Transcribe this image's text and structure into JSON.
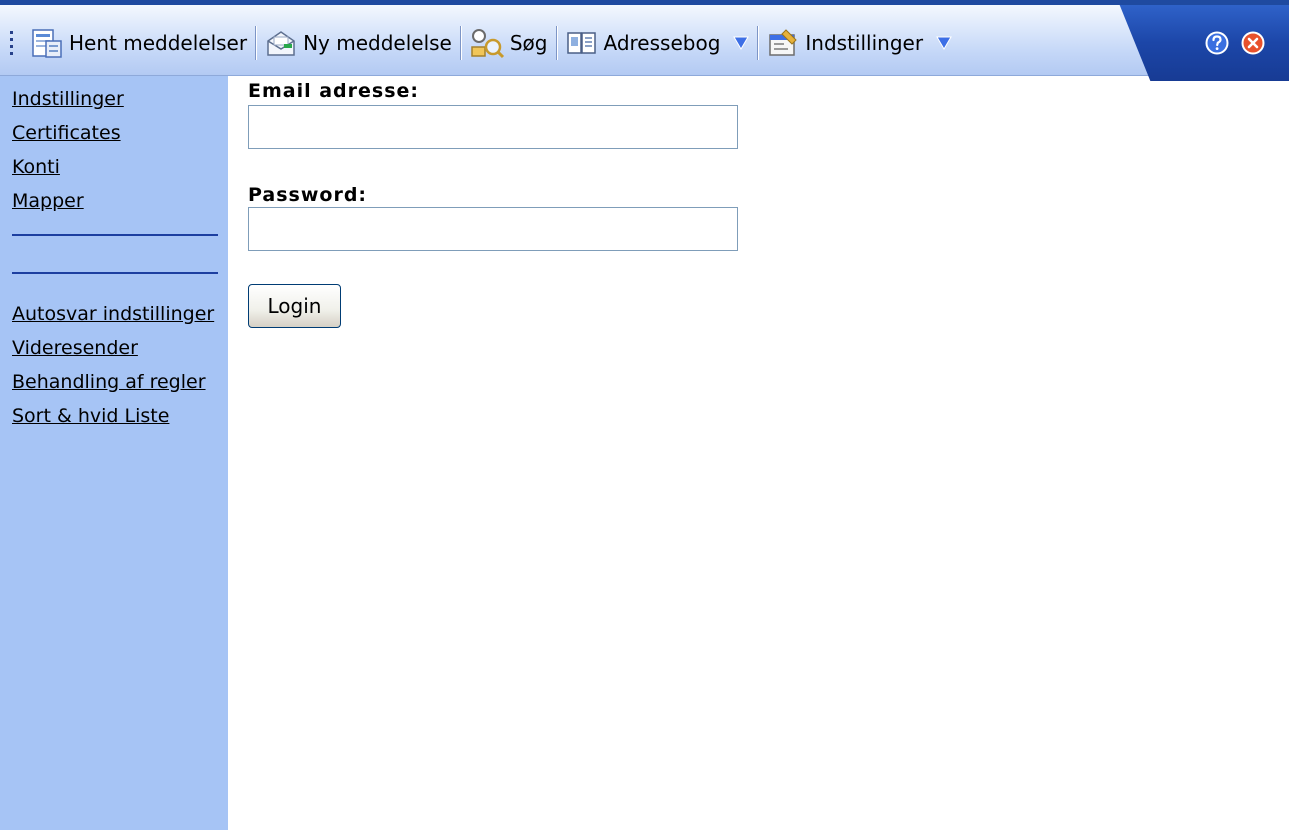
{
  "toolbar": {
    "get_messages": "Hent meddelelser",
    "new_message": "Ny meddelelse",
    "search": "Søg",
    "address_book": "Adressebog",
    "settings": "Indstillinger"
  },
  "sidebar": {
    "top_links": [
      "Indstillinger",
      "Certificates",
      "Konti",
      "Mapper"
    ],
    "bottom_links": [
      "Autosvar indstillinger",
      "Videresender",
      "Behandling af regler",
      "Sort & hvid Liste"
    ]
  },
  "form": {
    "email_label": "Email adresse:",
    "email_value": "",
    "password_label": "Password:",
    "password_value": "",
    "login_label": "Login"
  },
  "colors": {
    "sidebar_bg": "#a6c4f5",
    "toolbar_accent": "#1c46a8"
  },
  "icons": [
    "grip-icon",
    "get-mail-icon",
    "new-message-icon",
    "search-icon",
    "address-book-icon",
    "dropdown-arrow-icon",
    "settings-icon",
    "help-icon",
    "close-icon"
  ]
}
